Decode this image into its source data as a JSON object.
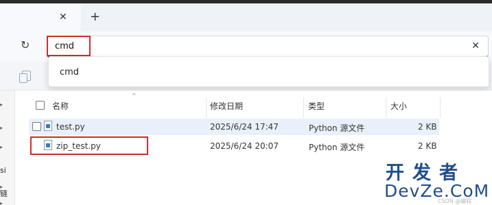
{
  "tabbar": {
    "close_glyph": "✕",
    "new_tab_glyph": "+"
  },
  "address_bar": {
    "refresh_glyph": "↻",
    "value": "cmd",
    "clear_glyph": "✕"
  },
  "suggestions": [
    "cmd"
  ],
  "left_pane": {
    "arrows": [
      "▸",
      "▸",
      "▸",
      "▸",
      "▸"
    ],
    "texts": [
      "si",
      "链"
    ]
  },
  "file_list": {
    "sort_caret": "^",
    "columns": {
      "name": "名称",
      "modified": "修改日期",
      "type": "类型",
      "size": "大小"
    },
    "rows": [
      {
        "name": "test.py",
        "modified": "2025/6/24 17:47",
        "type": "Python 源文件",
        "size": "2 KB",
        "selected": true
      },
      {
        "name": "zip_test.py",
        "modified": "2025/6/24 20:07",
        "type": "Python 源文件",
        "size": "2 KB",
        "highlighted": true
      }
    ]
  },
  "watermark": {
    "top": "开发者",
    "bottom": "DevZe.CoM",
    "small": "CSDN @编程"
  },
  "colors": {
    "highlight_red": "#d42a2a",
    "selection_blue": "#e8f1fb",
    "accent_blue": "#1f5fbf",
    "watermark_blue": "#1f4e8c"
  }
}
